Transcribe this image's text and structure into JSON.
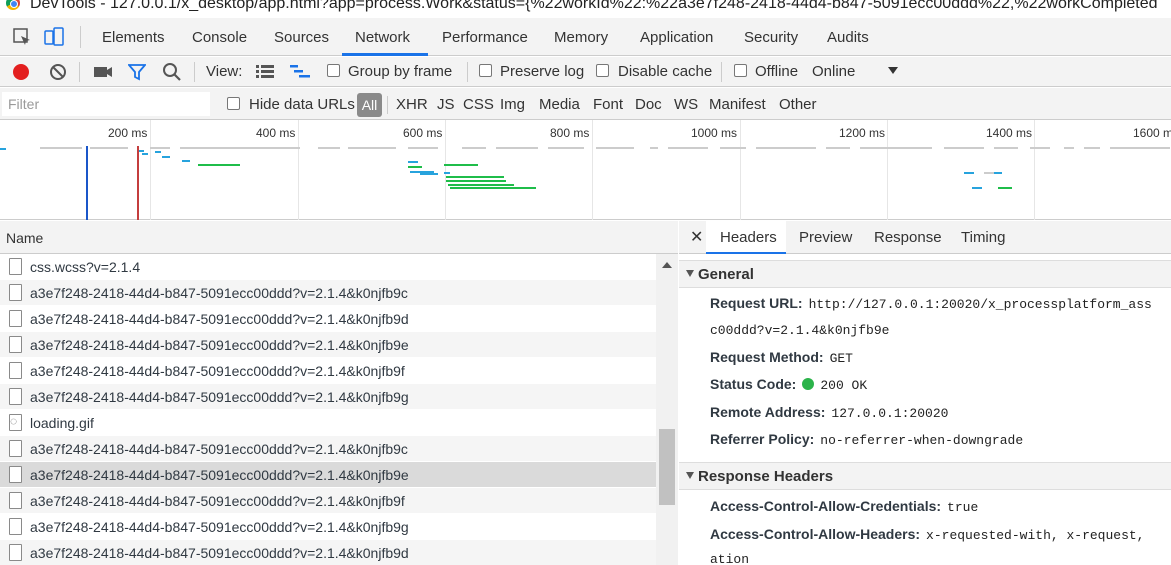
{
  "window": {
    "title": "DevTools - 127.0.0.1/x_desktop/app.html?app=process.Work&status={%22workId%22:%22a3e7f248-2418-44d4-b847-5091ecc00ddd%22,%22workCompleted"
  },
  "tabs": [
    "Elements",
    "Console",
    "Sources",
    "Network",
    "Performance",
    "Memory",
    "Application",
    "Security",
    "Audits"
  ],
  "active_tab": "Network",
  "toolbar": {
    "view_label": "View:",
    "group_by_frame": "Group by frame",
    "preserve_log": "Preserve log",
    "disable_cache": "Disable cache",
    "offline": "Offline",
    "throttle": "Online"
  },
  "filter": {
    "placeholder": "Filter",
    "hide_data_urls": "Hide data URLs",
    "all": "All",
    "types": [
      "XHR",
      "JS",
      "CSS",
      "Img",
      "Media",
      "Font",
      "Doc",
      "WS",
      "Manifest",
      "Other"
    ]
  },
  "overview": {
    "ticks": [
      "200 ms",
      "400 ms",
      "600 ms",
      "800 ms",
      "1000 ms",
      "1200 ms",
      "1400 ms",
      "1600 ms"
    ],
    "colors": {
      "waiting": "#27a3dd",
      "download": "#1fbd4a",
      "dom_loaded": "#1a56c9",
      "load": "#c43e3e",
      "idle": "#cccccc"
    }
  },
  "requests": {
    "header": "Name",
    "rows": [
      {
        "name": "css.wcss?v=2.1.4",
        "icon": "file-icon"
      },
      {
        "name": "a3e7f248-2418-44d4-b847-5091ecc00ddd?v=2.1.4&k0njfb9c",
        "icon": "file-icon"
      },
      {
        "name": "a3e7f248-2418-44d4-b847-5091ecc00ddd?v=2.1.4&k0njfb9d",
        "icon": "file-icon"
      },
      {
        "name": "a3e7f248-2418-44d4-b847-5091ecc00ddd?v=2.1.4&k0njfb9e",
        "icon": "file-icon"
      },
      {
        "name": "a3e7f248-2418-44d4-b847-5091ecc00ddd?v=2.1.4&k0njfb9f",
        "icon": "file-icon"
      },
      {
        "name": "a3e7f248-2418-44d4-b847-5091ecc00ddd?v=2.1.4&k0njfb9g",
        "icon": "file-icon"
      },
      {
        "name": "loading.gif",
        "icon": "gif-icon"
      },
      {
        "name": "a3e7f248-2418-44d4-b847-5091ecc00ddd?v=2.1.4&k0njfb9c",
        "icon": "file-icon"
      },
      {
        "name": "a3e7f248-2418-44d4-b847-5091ecc00ddd?v=2.1.4&k0njfb9e",
        "icon": "file-icon",
        "selected": true
      },
      {
        "name": "a3e7f248-2418-44d4-b847-5091ecc00ddd?v=2.1.4&k0njfb9f",
        "icon": "file-icon"
      },
      {
        "name": "a3e7f248-2418-44d4-b847-5091ecc00ddd?v=2.1.4&k0njfb9g",
        "icon": "file-icon"
      },
      {
        "name": "a3e7f248-2418-44d4-b847-5091ecc00ddd?v=2.1.4&k0njfb9d",
        "icon": "file-icon"
      }
    ]
  },
  "details": {
    "tabs": [
      "Headers",
      "Preview",
      "Response",
      "Timing"
    ],
    "active_tab": "Headers",
    "general": {
      "title": "General",
      "request_url_label": "Request URL:",
      "request_url": "http://127.0.0.1:20020/x_processplatform_ass",
      "request_url_cont": "c00ddd?v=2.1.4&k0njfb9e",
      "request_method_label": "Request Method:",
      "request_method": "GET",
      "status_code_label": "Status Code:",
      "status_code": "200 OK",
      "status_color": "#2bb34a",
      "remote_address_label": "Remote Address:",
      "remote_address": "127.0.0.1:20020",
      "referrer_policy_label": "Referrer Policy:",
      "referrer_policy": "no-referrer-when-downgrade"
    },
    "response_headers": {
      "title": "Response Headers",
      "acac_label": "Access-Control-Allow-Credentials:",
      "acac": "true",
      "acah_label": "Access-Control-Allow-Headers:",
      "acah": "x-requested-with, x-request,",
      "acah_cont": "ation"
    }
  }
}
